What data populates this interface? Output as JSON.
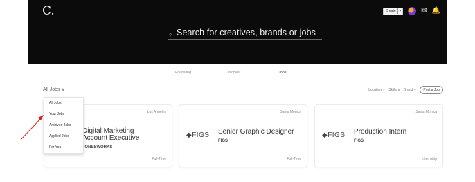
{
  "header": {
    "logo": "C.",
    "create_label": "Create",
    "search_placeholder": "Search for creatives, brands or jobs"
  },
  "tabs": {
    "following": "Following",
    "discover": "Discover",
    "jobs": "Jobs"
  },
  "filters": {
    "all_jobs": "All Jobs ∨",
    "location": "Location ∨",
    "skills": "Skills ∨",
    "brand": "Brand ∨",
    "post_job": "Post a Job"
  },
  "dropdown": {
    "items": [
      "All Jobs",
      "Your Jobs",
      "Archived Jobs",
      "Applied Jobs",
      "For You"
    ]
  },
  "jobs": [
    {
      "location": "Los Angeles",
      "title_line1": "Digital Marketing",
      "title_line2": "Account Executive",
      "company": "JONESWORKS",
      "type": "Full-Time"
    },
    {
      "location": "Santa Monica",
      "brand_logo": "FIGS",
      "title": "Senior Graphic Designer",
      "company": "FIGS",
      "type": "Full-Time"
    },
    {
      "location": "Santa Monica",
      "brand_logo": "FIGS",
      "title": "Production Intern",
      "company": "FIGS",
      "type": "Internship"
    }
  ],
  "icons": {
    "search": "search-icon",
    "mail": "mail-icon",
    "bell": "bell-icon",
    "avatar": "avatar"
  },
  "colors": {
    "header_bg": "#0b0b0b",
    "accent_blue": "#39b6ff",
    "annotation_red": "#e31d1d"
  }
}
